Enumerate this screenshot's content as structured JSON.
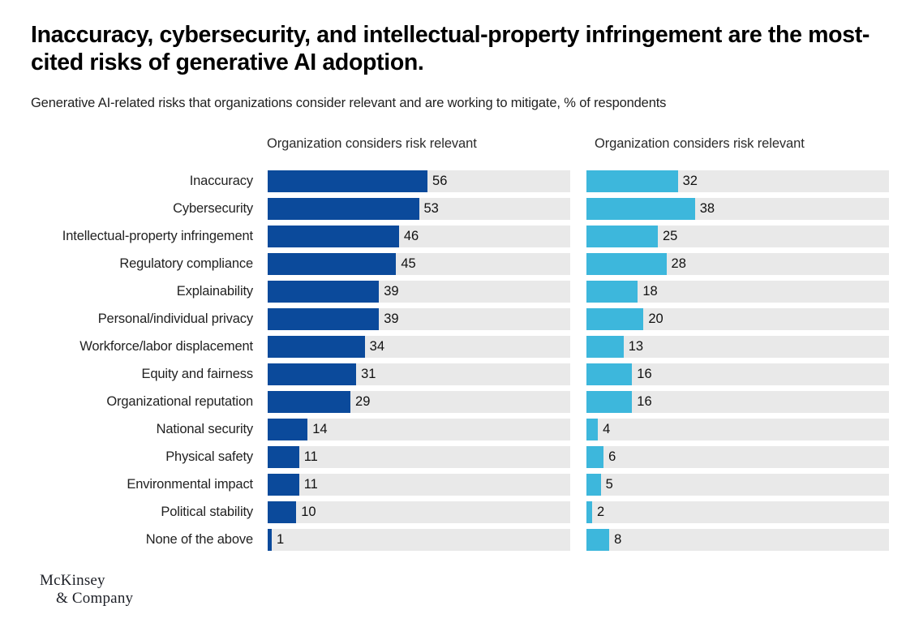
{
  "header": {
    "title": "Inaccuracy, cybersecurity, and intellectual-property infringement are the most-cited risks of generative AI adoption.",
    "subtitle": "Generative AI-related risks that organizations consider relevant and are working to mitigate, % of respondents"
  },
  "footer": {
    "logo_line1": "McKinsey",
    "logo_line2": "& Company"
  },
  "colors": {
    "dark_blue": "#0b4a9b",
    "light_blue": "#3db7dc",
    "track_gray": "#e9e9e9"
  },
  "chart_data": {
    "type": "bar",
    "title": "Inaccuracy, cybersecurity, and intellectual-property infringement are the most-cited risks of generative AI adoption.",
    "subtitle": "Generative AI-related risks that organizations consider relevant and are working to mitigate, % of respondents",
    "orientation": "horizontal",
    "xlabel": "",
    "ylabel": "",
    "xlim": [
      0,
      106
    ],
    "grid": false,
    "legend_position": "none",
    "panels": [
      {
        "key": "relevant",
        "header": "Organization considers risk relevant",
        "color": "#0b4a9b"
      },
      {
        "key": "mitigating",
        "header": "Organization considers risk relevant",
        "color": "#3db7dc"
      }
    ],
    "categories": [
      "Inaccuracy",
      "Cybersecurity",
      "Intellectual-property infringement",
      "Regulatory compliance",
      "Explainability",
      "Personal/individual privacy",
      "Workforce/labor displacement",
      "Equity and fairness",
      "Organizational reputation",
      "National security",
      "Physical safety",
      "Environmental impact",
      "Political stability",
      "None of the above"
    ],
    "series": [
      {
        "name": "Organization considers risk relevant",
        "color": "#0b4a9b",
        "values": [
          56,
          53,
          46,
          45,
          39,
          39,
          34,
          31,
          29,
          14,
          11,
          11,
          10,
          1
        ]
      },
      {
        "name": "Organization considers risk relevant",
        "color": "#3db7dc",
        "values": [
          32,
          38,
          25,
          28,
          18,
          20,
          13,
          16,
          16,
          4,
          6,
          5,
          2,
          8
        ]
      }
    ]
  }
}
